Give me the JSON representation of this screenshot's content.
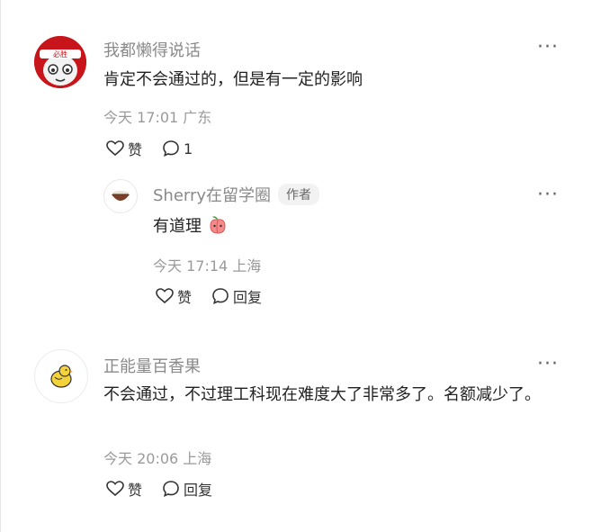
{
  "comments": [
    {
      "user": "我都懒得说话",
      "text": "肯定不会通过的，但是有一定的影响",
      "time": "今天 17:01",
      "location": "广东",
      "like_label": "赞",
      "reply_count": "1",
      "more_label": "···"
    },
    {
      "user": "Sherry在留学圈",
      "author_tag": "作者",
      "text": "有道理",
      "time": "今天 17:14",
      "location": "上海",
      "like_label": "赞",
      "reply_label": "回复",
      "more_label": "···"
    },
    {
      "user": "正能量百香果",
      "text": "不会通过，不过理工科现在难度大了非常多了。名额减少了。",
      "time": "今天 20:06",
      "location": "上海",
      "like_label": "赞",
      "reply_label": "回复",
      "more_label": "···"
    }
  ],
  "avatar_labels": {
    "first_avatar_band_text": "必胜"
  },
  "colors": {
    "name": "#8a8a8a",
    "meta": "#9a9a9a",
    "text": "#222222"
  }
}
